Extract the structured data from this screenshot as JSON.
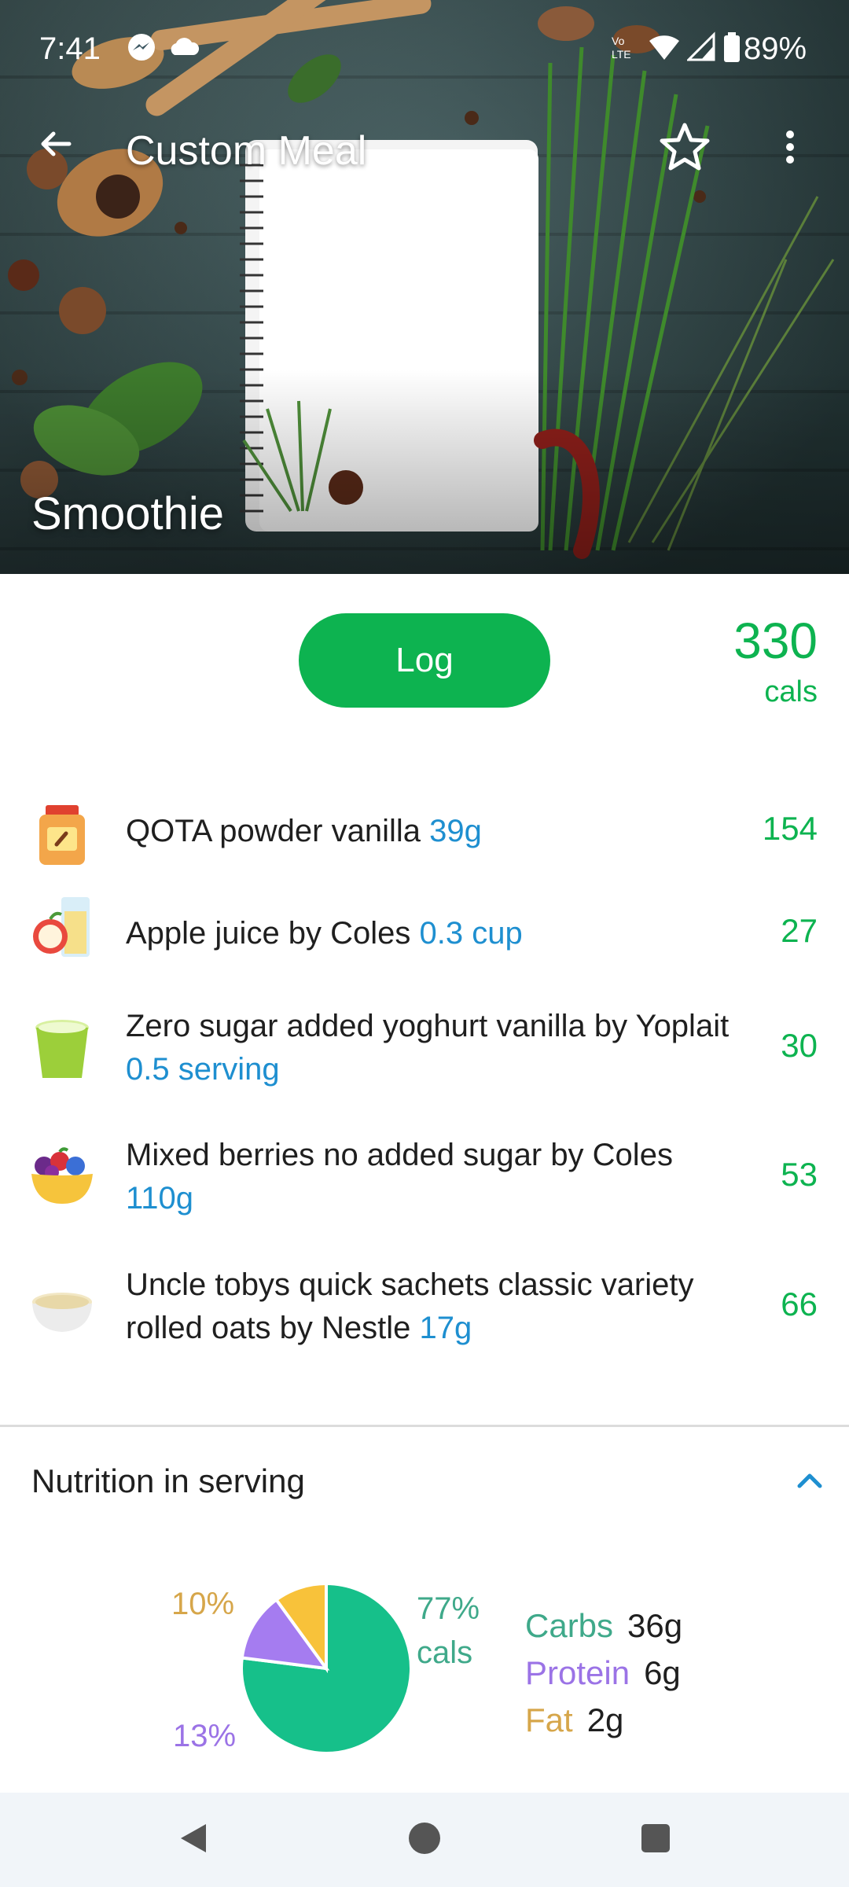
{
  "status_bar": {
    "time": "7:41",
    "battery": "89%",
    "icons": [
      "messenger-icon",
      "cloud-icon",
      "volte-icon",
      "wifi-icon",
      "cell-signal-icon",
      "battery-icon"
    ]
  },
  "app_bar": {
    "title": "Custom Meal",
    "back_icon": "arrow-left-icon",
    "favorite_icon": "star-outline-icon",
    "menu_icon": "more-vert-icon"
  },
  "meal": {
    "name": "Smoothie",
    "log_label": "Log",
    "total_calories": "330",
    "calories_unit": "cals"
  },
  "ingredients": [
    {
      "name": "QOTA powder vanilla",
      "amount": "39g",
      "calories": "154",
      "icon": "protein-powder-jar-icon"
    },
    {
      "name": "Apple juice by Coles",
      "amount": "0.3 cup",
      "calories": "27",
      "icon": "apple-juice-icon"
    },
    {
      "name": "Zero sugar added yoghurt vanilla by Yoplait",
      "amount": "0.5 serving",
      "calories": "30",
      "icon": "yoghurt-cup-icon"
    },
    {
      "name": "Mixed berries no added sugar by Coles",
      "amount": "110g",
      "calories": "53",
      "icon": "berries-bowl-icon"
    },
    {
      "name": "Uncle tobys quick sachets classic variety rolled oats by Nestle",
      "amount": "17g",
      "calories": "66",
      "icon": "oats-bowl-icon"
    }
  ],
  "nutrition": {
    "title": "Nutrition in serving",
    "toggle_icon": "chevron-up-icon",
    "pie": {
      "carbs_pct_label": "77%",
      "carbs_pct_unit": "cals",
      "protein_pct_label": "13%",
      "fat_pct_label": "10%",
      "carbs_fraction": 0.77,
      "protein_fraction": 0.13,
      "fat_fraction": 0.1
    },
    "macros": [
      {
        "name": "Carbs",
        "value": "36g",
        "color": "#3fa98a"
      },
      {
        "name": "Protein",
        "value": "6g",
        "color": "#9b73e6"
      },
      {
        "name": "Fat",
        "value": "2g",
        "color": "#d6a64a"
      }
    ],
    "colors": {
      "carbs": "#16c08a",
      "protein": "#a57cf0",
      "fat": "#f8c23a"
    }
  },
  "nav_bar": {
    "back_icon": "nav-back-icon",
    "home_icon": "nav-home-icon",
    "recents_icon": "nav-recents-icon"
  },
  "theme": {
    "accent": "#0db350",
    "amount_blue": "#1e8fd0"
  }
}
